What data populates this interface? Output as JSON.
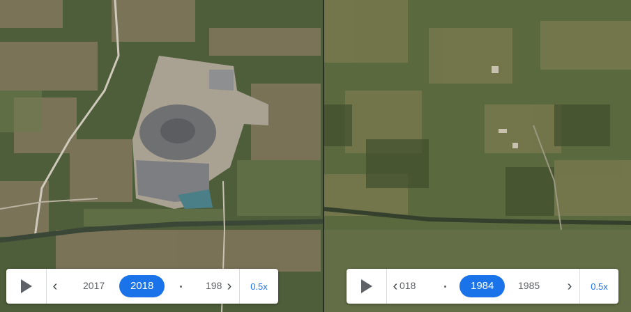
{
  "left_timeline": {
    "play_label": "play",
    "prev_label": "‹",
    "next_label": "›",
    "year_prev": "2017",
    "year_active": "2018",
    "year_next_partial": "198",
    "speed": "0.5x"
  },
  "right_timeline": {
    "play_label": "play",
    "prev_label": "‹",
    "next_label": "›",
    "year_prev_partial": "018",
    "year_active": "1984",
    "year_next": "1985",
    "speed": "0.5x"
  },
  "colors": {
    "accent": "#1a73e8",
    "icon": "#5f6368",
    "panel_bg": "#ffffff"
  }
}
